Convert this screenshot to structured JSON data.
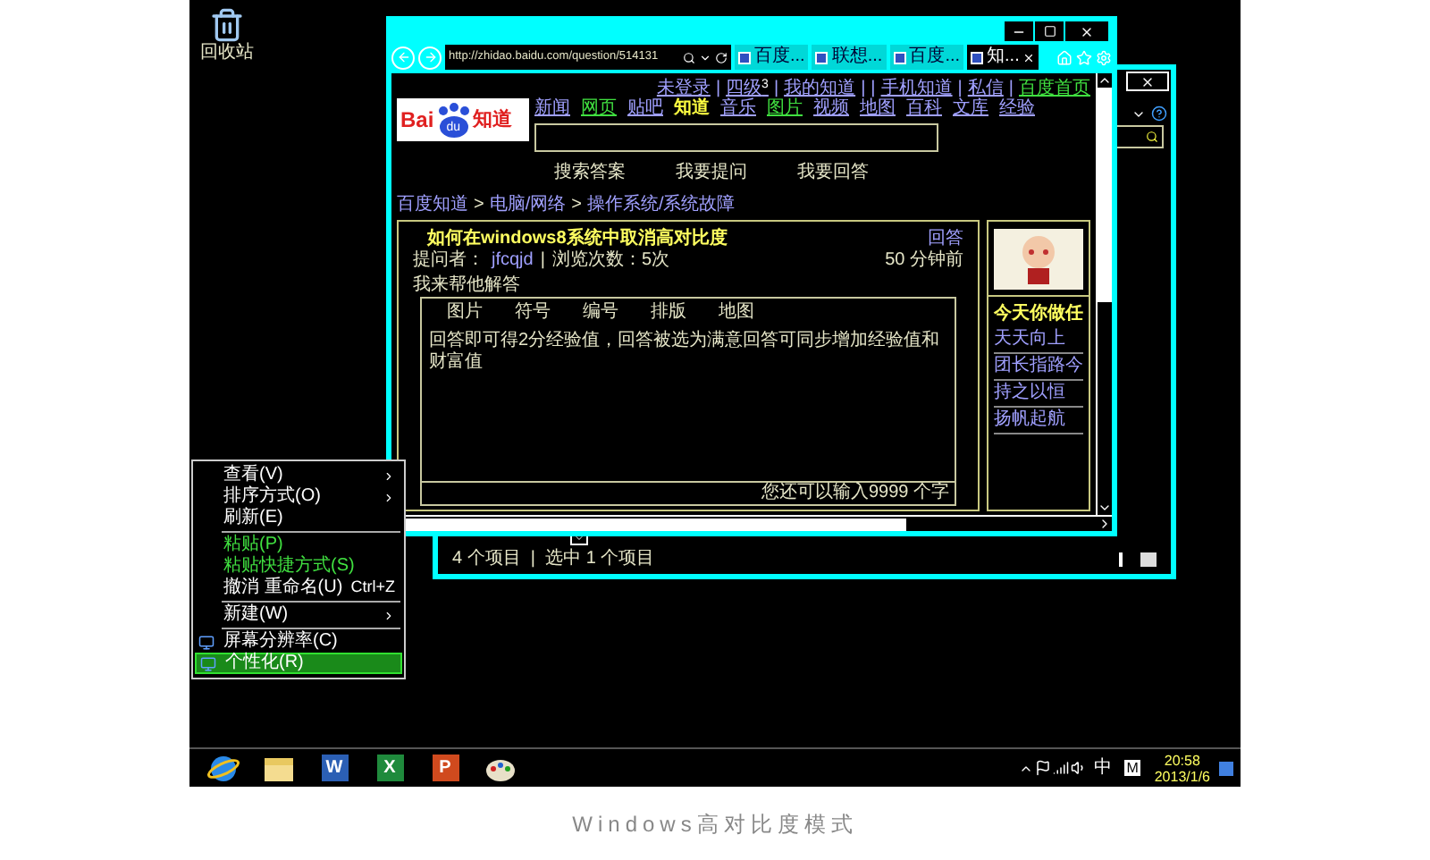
{
  "desktop_icons": [
    {
      "label": "回收站"
    }
  ],
  "explorer_window": {
    "status": "4 个项目  |  选中 1 个项目"
  },
  "browser": {
    "url": "http://zhidao.baidu.com/question/514131",
    "tabs": [
      {
        "label": "百度...",
        "selected": false
      },
      {
        "label": "联想...",
        "selected": false
      },
      {
        "label": "百度...",
        "selected": false
      },
      {
        "label": "知...",
        "selected": true
      }
    ],
    "logo": {
      "text": "Bai",
      "paw_text": "du",
      "suffix": "知道"
    },
    "top_links": [
      {
        "kind": "link",
        "label": "未登录",
        "visited": false
      },
      {
        "kind": "sep",
        "label": "|"
      },
      {
        "kind": "link",
        "label": "四级",
        "badge": "3",
        "visited": false
      },
      {
        "kind": "sep",
        "label": "|"
      },
      {
        "kind": "link",
        "label": "我的知道",
        "visited": false
      },
      {
        "kind": "sep",
        "label": "|"
      },
      {
        "kind": "sep",
        "label": "|"
      },
      {
        "kind": "link",
        "label": "手机知道",
        "visited": false
      },
      {
        "kind": "sep",
        "label": "|"
      },
      {
        "kind": "link",
        "label": "私信",
        "visited": false
      },
      {
        "kind": "sep",
        "label": "|"
      },
      {
        "kind": "link",
        "label": "百度首页",
        "visited": true
      }
    ],
    "nav": [
      {
        "label": "新闻",
        "selected": false,
        "visited": false
      },
      {
        "label": "网页",
        "selected": false,
        "visited": true
      },
      {
        "label": "贴吧",
        "selected": false,
        "visited": false
      },
      {
        "label": "知道",
        "selected": true,
        "visited": false
      },
      {
        "label": "音乐",
        "selected": false,
        "visited": false
      },
      {
        "label": "图片",
        "selected": false,
        "visited": true
      },
      {
        "label": "视频",
        "selected": false,
        "visited": false
      },
      {
        "label": "地图",
        "selected": false,
        "visited": false
      },
      {
        "label": "百科",
        "selected": false,
        "visited": false
      },
      {
        "label": "文库",
        "selected": false,
        "visited": false
      },
      {
        "label": "经验",
        "selected": false,
        "visited": false
      }
    ],
    "actions": [
      "搜索答案",
      "我要提问",
      "我要回答"
    ],
    "breadcrumb": [
      {
        "kind": "link",
        "label": "百度知道"
      },
      {
        "kind": "sep",
        "label": ">"
      },
      {
        "kind": "link",
        "label": "电脑/网络"
      },
      {
        "kind": "sep",
        "label": ">"
      },
      {
        "kind": "link",
        "label": "操作系统/系统故障"
      }
    ],
    "question": {
      "title": "如何在windows8系统中取消高对比度",
      "answer_link": "回答",
      "asker_label": "提问者：",
      "asker": "jfcqjd",
      "separator": "|",
      "views": "浏览次数：5次",
      "time": "50 分钟前"
    },
    "answer_heading": "我来帮他解答",
    "editor": {
      "toolbar": [
        "图片",
        "符号",
        "编号",
        "排版",
        "地图"
      ],
      "placeholder": "回答即可得2分经验值，回答被选为满意回答可同步增加经验值和财富值",
      "counter": "您还可以输入9999 个字"
    },
    "sidebar": {
      "heading": "今天你做任",
      "links": [
        "天天向上",
        "团长指路今",
        "持之以恒",
        "扬帆起航"
      ]
    }
  },
  "context_menu": [
    {
      "kind": "item",
      "label": "查看(V)",
      "submenu": true,
      "disabled": false,
      "icon": false,
      "selected": false
    },
    {
      "kind": "item",
      "label": "排序方式(O)",
      "submenu": true,
      "disabled": false,
      "icon": false,
      "selected": false
    },
    {
      "kind": "item",
      "label": "刷新(E)",
      "submenu": false,
      "disabled": false,
      "icon": false,
      "selected": false
    },
    {
      "kind": "separator"
    },
    {
      "kind": "item",
      "label": "粘贴(P)",
      "submenu": false,
      "disabled": true,
      "icon": false,
      "selected": false
    },
    {
      "kind": "item",
      "label": "粘贴快捷方式(S)",
      "submenu": false,
      "disabled": true,
      "icon": false,
      "selected": false
    },
    {
      "kind": "item",
      "label": "撤消 重命名(U)",
      "shortcut": "Ctrl+Z",
      "submenu": false,
      "disabled": false,
      "icon": false,
      "selected": false
    },
    {
      "kind": "separator"
    },
    {
      "kind": "item",
      "label": "新建(W)",
      "submenu": true,
      "disabled": false,
      "icon": false,
      "selected": false
    },
    {
      "kind": "separator"
    },
    {
      "kind": "item",
      "label": "屏幕分辨率(C)",
      "submenu": false,
      "disabled": false,
      "icon": true,
      "selected": false
    },
    {
      "kind": "item",
      "label": "个性化(R)",
      "submenu": false,
      "disabled": false,
      "icon": true,
      "selected": true
    }
  ],
  "taskbar": {
    "apps": [
      {
        "kind": "ie"
      },
      {
        "kind": "explorer"
      },
      {
        "kind": "doc",
        "glyph": "W",
        "color": "#2b5fb4"
      },
      {
        "kind": "doc",
        "glyph": "X",
        "color": "#1f8a3c"
      },
      {
        "kind": "doc",
        "glyph": "P",
        "color": "#d04a1e"
      },
      {
        "kind": "paint"
      }
    ],
    "ime": "中",
    "ime_mode": "M",
    "time": "20:58",
    "date": "2013/1/6"
  },
  "caption": "Windows高对比度模式"
}
